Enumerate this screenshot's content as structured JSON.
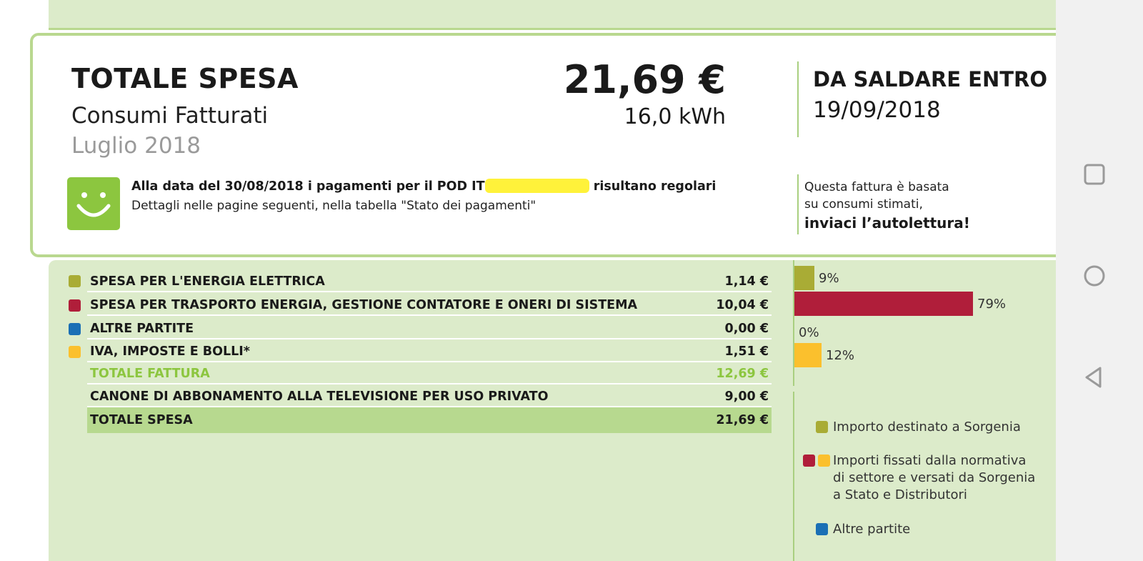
{
  "header": {
    "title": "TOTALE SPESA",
    "subtitle": "Consumi Fatturati",
    "period": "Luglio 2018",
    "amount": "21,69 €",
    "consumption": "16,0 kWh",
    "due_label": "DA SALDARE ENTRO",
    "due_date": "19/09/2018"
  },
  "payment_status": {
    "line1_prefix": "Alla data del 30/08/2018 i pagamenti per il POD IT",
    "line1_suffix": "risultano regolari",
    "line2": "Dettagli nelle pagine seguenti, nella tabella \"Stato dei pagamenti\"",
    "smiley_icon": "smiley-face-icon"
  },
  "estimate_note": {
    "line1": "Questa fattura è basata",
    "line2": "su consumi stimati,",
    "cta": "inviaci l’autolettura!"
  },
  "breakdown": {
    "rows": [
      {
        "label": "SPESA PER L'ENERGIA ELETTRICA",
        "value": "1,14 €",
        "color": "#a9ac35"
      },
      {
        "label": "SPESA PER TRASPORTO ENERGIA, GESTIONE CONTATORE E ONERI DI SISTEMA",
        "value": "10,04 €",
        "color": "#b01e3a"
      },
      {
        "label": "ALTRE PARTITE",
        "value": "0,00 €",
        "color": "#1a6fb5"
      },
      {
        "label": "IVA, IMPOSTE E BOLLI*",
        "value": "1,51 €",
        "color": "#fbc02d"
      }
    ],
    "total_invoice": {
      "label": "TOTALE FATTURA",
      "value": "12,69 €"
    },
    "tv_fee": {
      "label": "CANONE DI ABBONAMENTO ALLA TELEVISIONE PER USO PRIVATO",
      "value": "9,00 €"
    },
    "grand_total": {
      "label": "TOTALE SPESA",
      "value": "21,69 €"
    }
  },
  "chart_data": {
    "type": "bar",
    "categories": [
      "SPESA PER L'ENERGIA ELETTRICA",
      "SPESA PER TRASPORTO ENERGIA, GESTIONE CONTATORE E ONERI DI SISTEMA",
      "ALTRE PARTITE",
      "IVA, IMPOSTE E BOLLI*"
    ],
    "values": [
      9,
      79,
      0,
      12
    ],
    "labels": [
      "9%",
      "79%",
      "0%",
      "12%"
    ],
    "colors": [
      "#a9ac35",
      "#b01e3a",
      "#1a6fb5",
      "#fbc02d"
    ],
    "orientation": "horizontal",
    "xlim": [
      0,
      100
    ],
    "grid": false
  },
  "legend": {
    "items": [
      {
        "text_lines": [
          "Importo destinato a Sorgenia"
        ],
        "colors": [
          "#a9ac35"
        ]
      },
      {
        "text_lines": [
          "Importi fissati dalla normativa",
          "di settore e versati da Sorgenia",
          "a Stato e Distributori"
        ],
        "colors": [
          "#b01e3a",
          "#fbc02d"
        ]
      },
      {
        "text_lines": [
          "Altre partite"
        ],
        "colors": [
          "#1a6fb5"
        ]
      }
    ]
  },
  "nav": {
    "icons": [
      "recent-apps-icon",
      "home-icon",
      "back-icon"
    ]
  }
}
